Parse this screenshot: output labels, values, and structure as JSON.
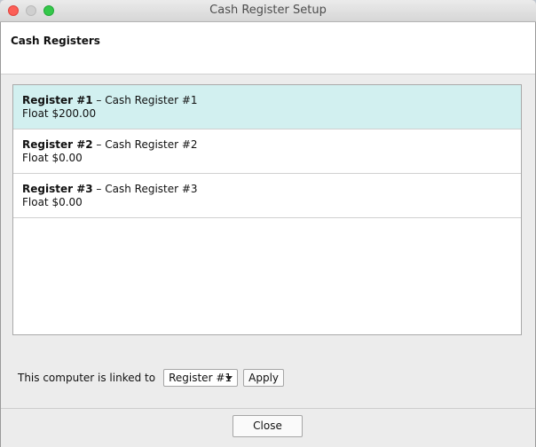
{
  "window": {
    "title": "Cash Register Setup"
  },
  "header": {
    "title": "Cash Registers"
  },
  "registers": [
    {
      "id": "Register #1",
      "separator": " – ",
      "name": "Cash Register #1",
      "float": "Float $200.00",
      "selected": true
    },
    {
      "id": "Register #2",
      "separator": " – ",
      "name": "Cash Register #2",
      "float": "Float $0.00",
      "selected": false
    },
    {
      "id": "Register #3",
      "separator": " – ",
      "name": "Cash Register #3",
      "float": "Float $0.00",
      "selected": false
    }
  ],
  "link": {
    "label": "This computer is linked to",
    "selected_value": "Register #1",
    "apply_label": "Apply"
  },
  "footer": {
    "close_label": "Close"
  }
}
